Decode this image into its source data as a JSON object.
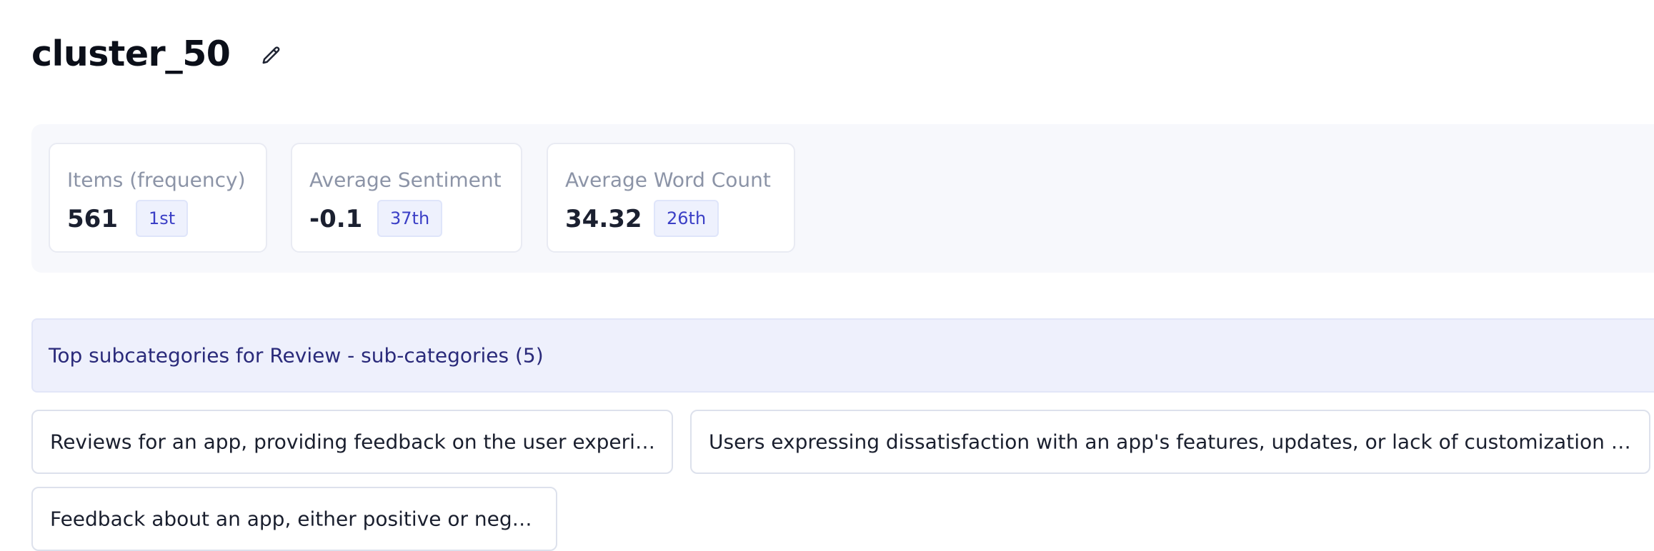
{
  "page": {
    "title": "cluster_50",
    "edit_icon": "pencil-icon"
  },
  "stats": [
    {
      "label": "Items (frequency)",
      "value": "561",
      "rank": "1st"
    },
    {
      "label": "Average Sentiment",
      "value": "-0.1",
      "rank": "37th"
    },
    {
      "label": "Average Word Count",
      "value": "34.32",
      "rank": "26th"
    }
  ],
  "subcategories": {
    "header": "Top subcategories for Review - sub-categories (5)",
    "items": [
      "Reviews for an app, providing feedback on the user experience.",
      "Users expressing dissatisfaction with an app's features, updates, or lack of customization optio...",
      "Feedback about an app, either positive or negative."
    ]
  },
  "colors": {
    "panel_bg": "#f7f8fc",
    "badge_bg": "#eef1fd",
    "badge_text": "#3b3fc6",
    "header_bg": "#eef0fc",
    "header_text": "#2a2a7a"
  }
}
